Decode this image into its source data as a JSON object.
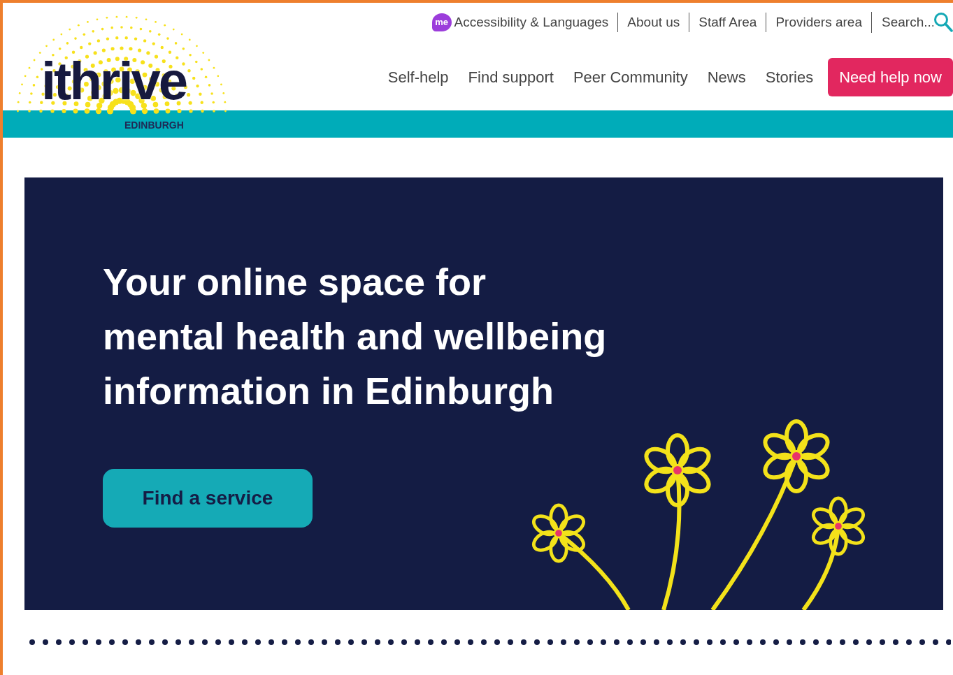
{
  "logo": {
    "wordmark": "ithrive",
    "place": "EDINBURGH"
  },
  "utility_nav": {
    "accessibility": {
      "badge": "me",
      "label": "Accessibility & Languages"
    },
    "links": [
      "About us",
      "Staff Area",
      "Providers area"
    ],
    "search": {
      "placeholder": "Search..."
    }
  },
  "main_nav": {
    "links": [
      "Self-help",
      "Find support",
      "Peer Community",
      "News",
      "Stories"
    ],
    "cta": "Need help now"
  },
  "hero": {
    "lines": [
      "Your online space for",
      "mental health and wellbeing",
      "information in Edinburgh"
    ],
    "button": "Find a service"
  }
}
